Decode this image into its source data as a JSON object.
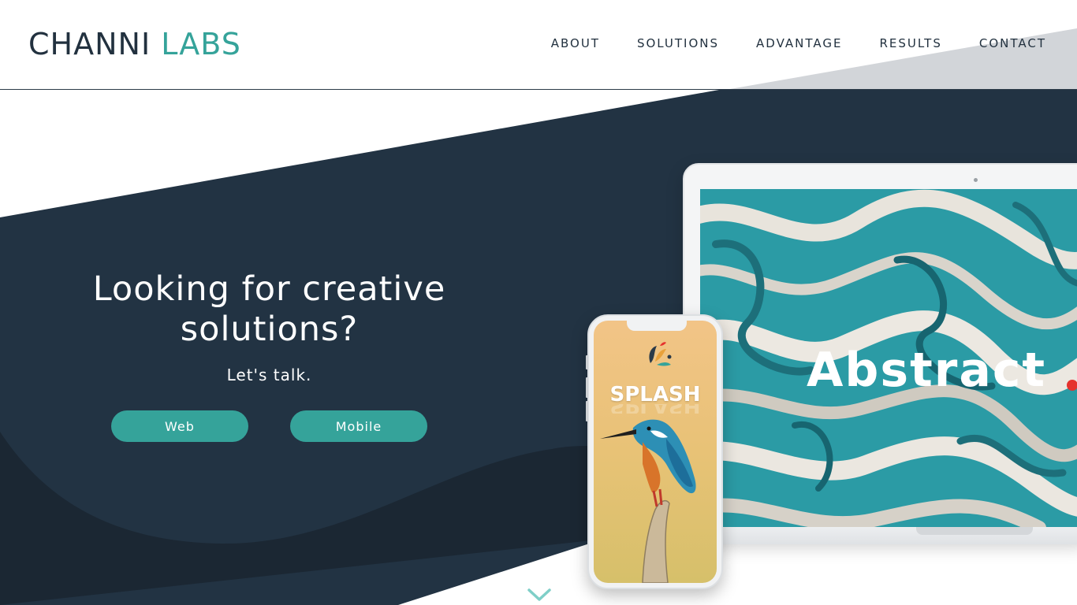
{
  "brand": {
    "part1": "CHANNI",
    "part2": "LABS"
  },
  "nav": {
    "items": [
      {
        "label": "ABOUT"
      },
      {
        "label": "SOLUTIONS"
      },
      {
        "label": "ADVANTAGE"
      },
      {
        "label": "RESULTS"
      },
      {
        "label": "CONTACT"
      }
    ]
  },
  "hero": {
    "title_line1": "Looking for creative",
    "title_line2": "solutions?",
    "subtitle": "Let's talk.",
    "buttons": {
      "web": "Web",
      "mobile": "Mobile"
    }
  },
  "laptop_screen": {
    "text": "Abstract"
  },
  "phone_screen": {
    "text": "SPLASH"
  },
  "icons": {
    "scroll": "chevron-down-icon",
    "splash_logo": "splash-logo-icon"
  },
  "colors": {
    "navy": "#22313f",
    "navy_dark": "#1b2733",
    "teal": "#35a39a",
    "accent_red": "#e5322d"
  }
}
